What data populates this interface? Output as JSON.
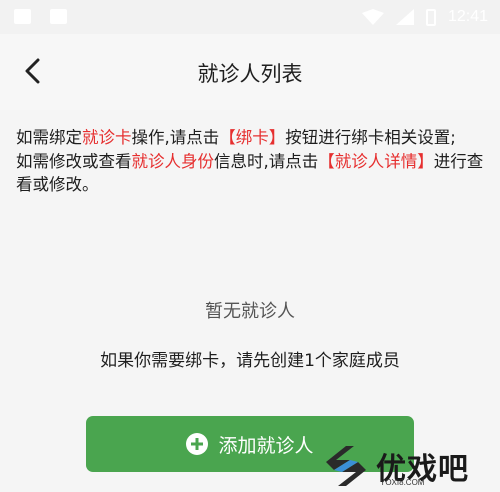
{
  "status_bar": {
    "time": "12:41"
  },
  "header": {
    "title": "就诊人列表",
    "back_icon": "chevron-left-icon"
  },
  "notice": {
    "line1_a": "如需绑定",
    "line1_red": "就诊卡",
    "line1_b": "操作,请点击",
    "line1_red2": "【绑卡】",
    "line1_c": "按钮进行绑卡相关设置;",
    "line2_a": "如需修改或查看",
    "line2_red": "就诊人身份",
    "line2_b": "信息时,请点击",
    "line2_red2": "【就诊人详情】",
    "line2_c": "进行查看或修改。"
  },
  "empty_state": {
    "title": "暂无就诊人",
    "hint": "如果你需要绑卡，请先创建1个家庭成员"
  },
  "add_button": {
    "label": "添加就诊人",
    "icon": "plus-circle-icon"
  },
  "watermark": {
    "brand": "优戏吧",
    "url": "YOXI8.COM"
  },
  "colors": {
    "accent_green": "#4aa54f",
    "highlight_red": "#e62f2f"
  }
}
